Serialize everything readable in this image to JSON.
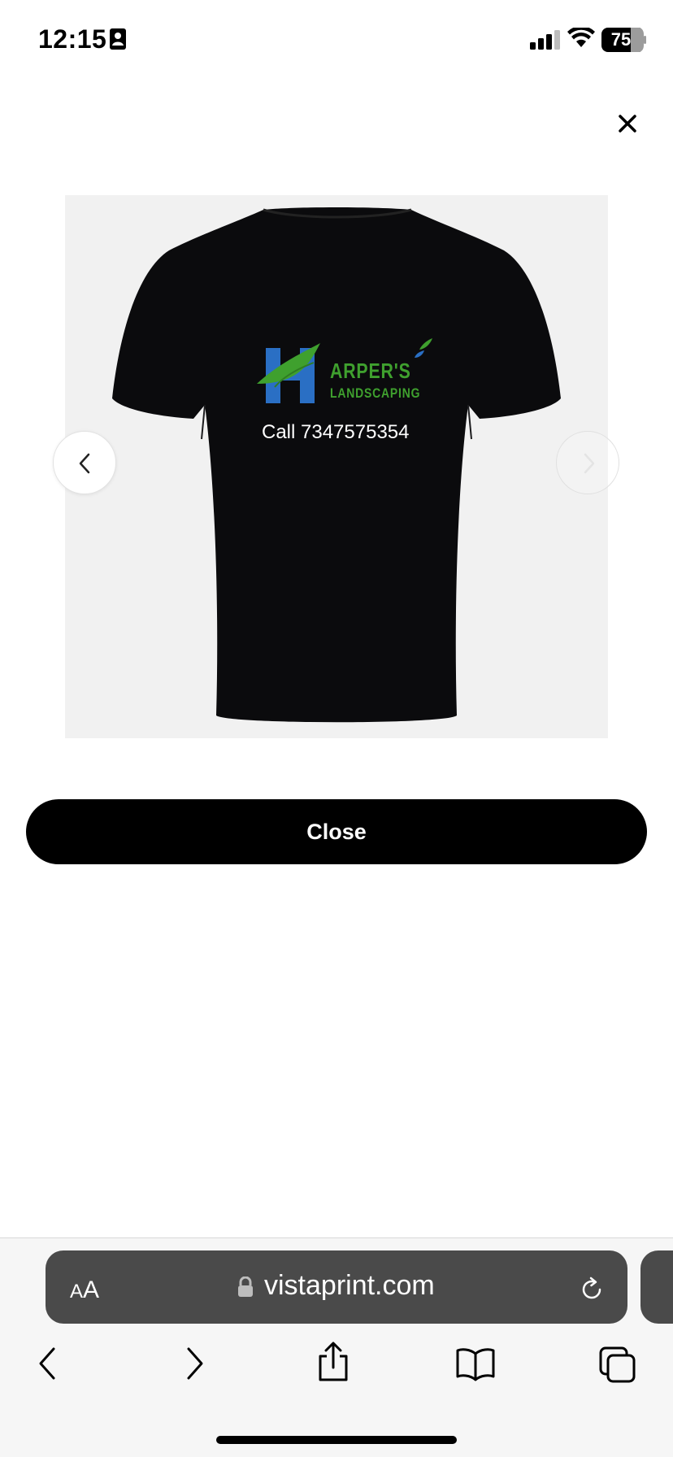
{
  "status_bar": {
    "time": "12:15",
    "battery": "75",
    "icons": [
      "contact-card-icon",
      "cellular-signal-icon",
      "wifi-icon",
      "battery-icon"
    ]
  },
  "modal": {
    "close_icon": "close-icon",
    "product": {
      "logo_line1": "ARPER'S",
      "logo_line2": "LANDSCAPING",
      "phone_text": "Call 7347575354",
      "shirt_color": "#0b0b0d",
      "background_color": "#f1f1f1",
      "logo_colors": {
        "green": "#3fa02e",
        "blue": "#2a6fc4"
      }
    },
    "carousel": {
      "prev_icon": "chevron-left-icon",
      "next_icon": "chevron-right-icon"
    },
    "close_button_label": "Close"
  },
  "browser": {
    "text_size_label_large": "A",
    "text_size_label_small": "A",
    "url": "vistaprint.com",
    "address_bar_color": "#4a4a4a",
    "toolbar": [
      "back-icon",
      "forward-icon",
      "share-icon",
      "bookmarks-icon",
      "tabs-icon"
    ]
  }
}
